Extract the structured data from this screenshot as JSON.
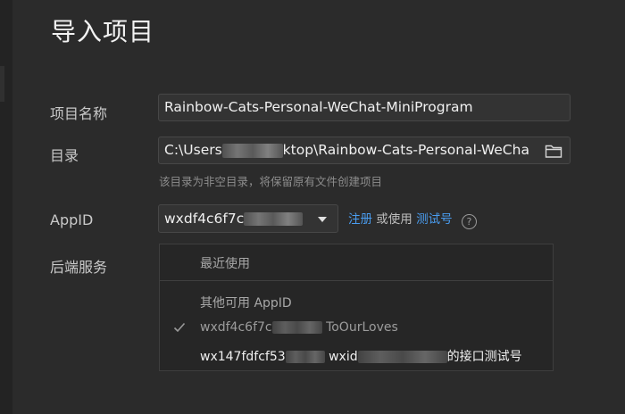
{
  "page": {
    "title": "导入项目"
  },
  "form": {
    "project_name": {
      "label": "项目名称",
      "value": "Rainbow-Cats-Personal-WeChat-MiniProgram"
    },
    "directory": {
      "label": "目录",
      "value_prefix": "C:\\Users",
      "value_suffix": "ktop\\Rainbow-Cats-Personal-WeCha",
      "hint": "该目录为非空目录，将保留原有文件创建项目",
      "browse_icon": "folder-icon"
    },
    "appid": {
      "label": "AppID",
      "value": "wxdf4c6f7c",
      "register_link": "注册",
      "or_use_text": "或使用",
      "test_account_link": "测试号",
      "help_icon": "?"
    },
    "backend": {
      "label": "后端服务"
    }
  },
  "dropdown": {
    "recent_header": "最近使用",
    "other_header": "其他可用 AppID",
    "items": [
      {
        "prefix": "wxdf4c6f7c",
        "suffix": "ToOurLoves",
        "selected": true
      },
      {
        "prefix": "wx147fdfcf53",
        "middle": "wxid",
        "suffix": "的接口测试号",
        "selected": false
      }
    ]
  },
  "colors": {
    "background": "#2b2b2b",
    "link": "#4a9df0"
  }
}
